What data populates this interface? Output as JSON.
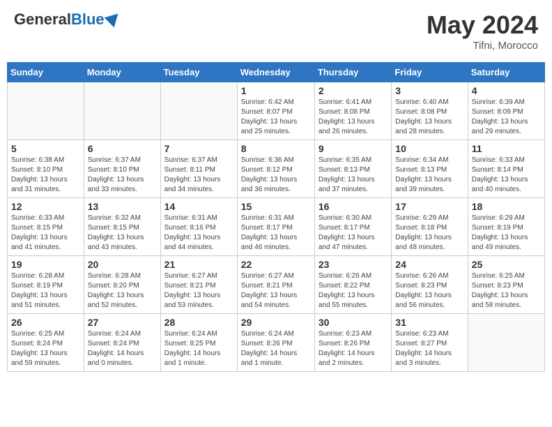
{
  "header": {
    "logo_general": "General",
    "logo_blue": "Blue",
    "month_year": "May 2024",
    "location": "Tifni, Morocco"
  },
  "days_of_week": [
    "Sunday",
    "Monday",
    "Tuesday",
    "Wednesday",
    "Thursday",
    "Friday",
    "Saturday"
  ],
  "weeks": [
    [
      {
        "day": "",
        "info": ""
      },
      {
        "day": "",
        "info": ""
      },
      {
        "day": "",
        "info": ""
      },
      {
        "day": "1",
        "info": "Sunrise: 6:42 AM\nSunset: 8:07 PM\nDaylight: 13 hours\nand 25 minutes."
      },
      {
        "day": "2",
        "info": "Sunrise: 6:41 AM\nSunset: 8:08 PM\nDaylight: 13 hours\nand 26 minutes."
      },
      {
        "day": "3",
        "info": "Sunrise: 6:40 AM\nSunset: 8:08 PM\nDaylight: 13 hours\nand 28 minutes."
      },
      {
        "day": "4",
        "info": "Sunrise: 6:39 AM\nSunset: 8:09 PM\nDaylight: 13 hours\nand 29 minutes."
      }
    ],
    [
      {
        "day": "5",
        "info": "Sunrise: 6:38 AM\nSunset: 8:10 PM\nDaylight: 13 hours\nand 31 minutes."
      },
      {
        "day": "6",
        "info": "Sunrise: 6:37 AM\nSunset: 8:10 PM\nDaylight: 13 hours\nand 33 minutes."
      },
      {
        "day": "7",
        "info": "Sunrise: 6:37 AM\nSunset: 8:11 PM\nDaylight: 13 hours\nand 34 minutes."
      },
      {
        "day": "8",
        "info": "Sunrise: 6:36 AM\nSunset: 8:12 PM\nDaylight: 13 hours\nand 36 minutes."
      },
      {
        "day": "9",
        "info": "Sunrise: 6:35 AM\nSunset: 8:13 PM\nDaylight: 13 hours\nand 37 minutes."
      },
      {
        "day": "10",
        "info": "Sunrise: 6:34 AM\nSunset: 8:13 PM\nDaylight: 13 hours\nand 39 minutes."
      },
      {
        "day": "11",
        "info": "Sunrise: 6:33 AM\nSunset: 8:14 PM\nDaylight: 13 hours\nand 40 minutes."
      }
    ],
    [
      {
        "day": "12",
        "info": "Sunrise: 6:33 AM\nSunset: 8:15 PM\nDaylight: 13 hours\nand 41 minutes."
      },
      {
        "day": "13",
        "info": "Sunrise: 6:32 AM\nSunset: 8:15 PM\nDaylight: 13 hours\nand 43 minutes."
      },
      {
        "day": "14",
        "info": "Sunrise: 6:31 AM\nSunset: 8:16 PM\nDaylight: 13 hours\nand 44 minutes."
      },
      {
        "day": "15",
        "info": "Sunrise: 6:31 AM\nSunset: 8:17 PM\nDaylight: 13 hours\nand 46 minutes."
      },
      {
        "day": "16",
        "info": "Sunrise: 6:30 AM\nSunset: 8:17 PM\nDaylight: 13 hours\nand 47 minutes."
      },
      {
        "day": "17",
        "info": "Sunrise: 6:29 AM\nSunset: 8:18 PM\nDaylight: 13 hours\nand 48 minutes."
      },
      {
        "day": "18",
        "info": "Sunrise: 6:29 AM\nSunset: 8:19 PM\nDaylight: 13 hours\nand 49 minutes."
      }
    ],
    [
      {
        "day": "19",
        "info": "Sunrise: 6:28 AM\nSunset: 8:19 PM\nDaylight: 13 hours\nand 51 minutes."
      },
      {
        "day": "20",
        "info": "Sunrise: 6:28 AM\nSunset: 8:20 PM\nDaylight: 13 hours\nand 52 minutes."
      },
      {
        "day": "21",
        "info": "Sunrise: 6:27 AM\nSunset: 8:21 PM\nDaylight: 13 hours\nand 53 minutes."
      },
      {
        "day": "22",
        "info": "Sunrise: 6:27 AM\nSunset: 8:21 PM\nDaylight: 13 hours\nand 54 minutes."
      },
      {
        "day": "23",
        "info": "Sunrise: 6:26 AM\nSunset: 8:22 PM\nDaylight: 13 hours\nand 55 minutes."
      },
      {
        "day": "24",
        "info": "Sunrise: 6:26 AM\nSunset: 8:23 PM\nDaylight: 13 hours\nand 56 minutes."
      },
      {
        "day": "25",
        "info": "Sunrise: 6:25 AM\nSunset: 8:23 PM\nDaylight: 13 hours\nand 58 minutes."
      }
    ],
    [
      {
        "day": "26",
        "info": "Sunrise: 6:25 AM\nSunset: 8:24 PM\nDaylight: 13 hours\nand 59 minutes."
      },
      {
        "day": "27",
        "info": "Sunrise: 6:24 AM\nSunset: 8:24 PM\nDaylight: 14 hours\nand 0 minutes."
      },
      {
        "day": "28",
        "info": "Sunrise: 6:24 AM\nSunset: 8:25 PM\nDaylight: 14 hours\nand 1 minute."
      },
      {
        "day": "29",
        "info": "Sunrise: 6:24 AM\nSunset: 8:26 PM\nDaylight: 14 hours\nand 1 minute."
      },
      {
        "day": "30",
        "info": "Sunrise: 6:23 AM\nSunset: 8:26 PM\nDaylight: 14 hours\nand 2 minutes."
      },
      {
        "day": "31",
        "info": "Sunrise: 6:23 AM\nSunset: 8:27 PM\nDaylight: 14 hours\nand 3 minutes."
      },
      {
        "day": "",
        "info": ""
      }
    ]
  ]
}
